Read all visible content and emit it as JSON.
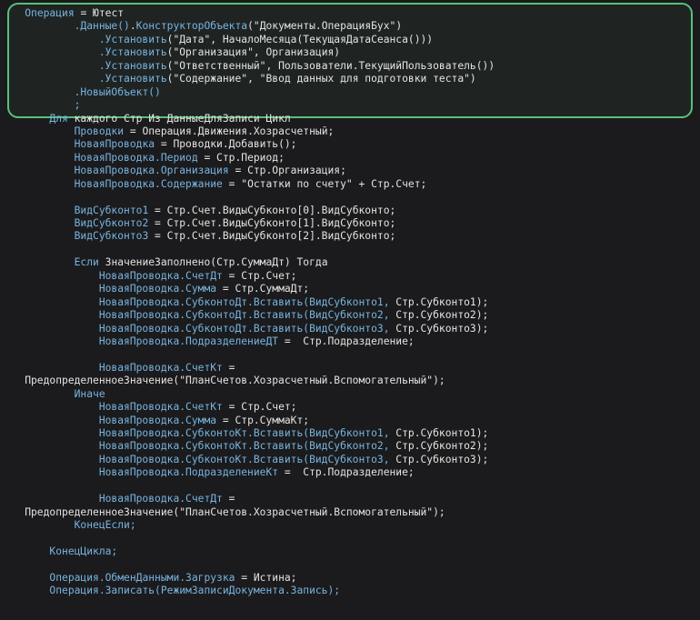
{
  "lines": [
    [
      {
        "t": "    "
      },
      {
        "t": "Операция",
        "c": "id"
      },
      {
        "t": " = Ютест"
      }
    ],
    [
      {
        "t": "            "
      },
      {
        "t": ".Данные()",
        "c": "id"
      },
      {
        "t": "."
      },
      {
        "t": "КонструкторОбъекта",
        "c": "id"
      },
      {
        "t": "(\"Документы.ОперацияБух\")"
      }
    ],
    [
      {
        "t": "                "
      },
      {
        "t": ".Установить",
        "c": "id"
      },
      {
        "t": "(\"Дата\", НачалоМесяца(ТекущаяДатаСеанса()))"
      }
    ],
    [
      {
        "t": "                "
      },
      {
        "t": ".Установить",
        "c": "id"
      },
      {
        "t": "(\"Организация\", Организация)"
      }
    ],
    [
      {
        "t": "                "
      },
      {
        "t": ".Установить",
        "c": "id"
      },
      {
        "t": "(\"Ответственный\", Пользователи.ТекущийПользователь())"
      }
    ],
    [
      {
        "t": "                "
      },
      {
        "t": ".Установить",
        "c": "id"
      },
      {
        "t": "(\"Содержание\", \"Ввод данных для подготовки теста\")"
      }
    ],
    [
      {
        "t": "            "
      },
      {
        "t": ".НовыйОбъект()",
        "c": "id"
      }
    ],
    [
      {
        "t": "            "
      },
      {
        "t": ";",
        "c": "id"
      }
    ],
    [
      {
        "t": "        "
      },
      {
        "t": "Для",
        "c": "kw"
      },
      {
        "t": " каждого Стр Из ДанныеДляЗаписи Цикл"
      }
    ],
    [
      {
        "t": "            "
      },
      {
        "t": "Проводки",
        "c": "id"
      },
      {
        "t": " = Операция.Движения.Хозрасчетный;"
      }
    ],
    [
      {
        "t": "            "
      },
      {
        "t": "НоваяПроводка",
        "c": "id"
      },
      {
        "t": " = Проводки.Добавить();"
      }
    ],
    [
      {
        "t": "            "
      },
      {
        "t": "НоваяПроводка.Период",
        "c": "id"
      },
      {
        "t": " = Стр.Период;"
      }
    ],
    [
      {
        "t": "            "
      },
      {
        "t": "НоваяПроводка.Организация",
        "c": "id"
      },
      {
        "t": " = Стр.Организация;"
      }
    ],
    [
      {
        "t": "            "
      },
      {
        "t": "НоваяПроводка.Содержание",
        "c": "id"
      },
      {
        "t": " = \"Остатки по счету\" + Стр.Счет;"
      }
    ],
    [
      {
        "t": ""
      }
    ],
    [
      {
        "t": "            "
      },
      {
        "t": "ВидСубконто1",
        "c": "id"
      },
      {
        "t": " = Стр.Счет.ВидыСубконто[0].ВидСубконто;"
      }
    ],
    [
      {
        "t": "            "
      },
      {
        "t": "ВидСубконто2",
        "c": "id"
      },
      {
        "t": " = Стр.Счет.ВидыСубконто[1].ВидСубконто;"
      }
    ],
    [
      {
        "t": "            "
      },
      {
        "t": "ВидСубконто3",
        "c": "id"
      },
      {
        "t": " = Стр.Счет.ВидыСубконто[2].ВидСубконто;"
      }
    ],
    [
      {
        "t": ""
      }
    ],
    [
      {
        "t": "            "
      },
      {
        "t": "Если",
        "c": "kw"
      },
      {
        "t": " ЗначениеЗаполнено(Стр.СуммаДт) Тогда"
      }
    ],
    [
      {
        "t": "                "
      },
      {
        "t": "НоваяПроводка.СчетДт",
        "c": "id"
      },
      {
        "t": " = Стр.Счет;"
      }
    ],
    [
      {
        "t": "                "
      },
      {
        "t": "НоваяПроводка.Сумма",
        "c": "id"
      },
      {
        "t": " = Стр.СуммаДт;"
      }
    ],
    [
      {
        "t": "                "
      },
      {
        "t": "НоваяПроводка.СубконтоДт.Вставить(ВидСубконто1,",
        "c": "id"
      },
      {
        "t": " Стр.Субконто1);"
      }
    ],
    [
      {
        "t": "                "
      },
      {
        "t": "НоваяПроводка.СубконтоДт.Вставить(ВидСубконто2,",
        "c": "id"
      },
      {
        "t": " Стр.Субконто2);"
      }
    ],
    [
      {
        "t": "                "
      },
      {
        "t": "НоваяПроводка.СубконтоДт.Вставить(ВидСубконто3,",
        "c": "id"
      },
      {
        "t": " Стр.Субконто3);"
      }
    ],
    [
      {
        "t": "                "
      },
      {
        "t": "НоваяПроводка.ПодразделениеДТ",
        "c": "id"
      },
      {
        "t": " =  Стр.Подразделение;"
      }
    ],
    [
      {
        "t": ""
      }
    ],
    [
      {
        "t": "                "
      },
      {
        "t": "НоваяПроводка.СчетКт",
        "c": "id"
      },
      {
        "t": " ="
      }
    ],
    [
      {
        "t": "    ПредопределенноеЗначение(\"ПланСчетов.Хозрасчетный.Вспомогательный\");"
      }
    ],
    [
      {
        "t": "            "
      },
      {
        "t": "Иначе",
        "c": "kw"
      }
    ],
    [
      {
        "t": "                "
      },
      {
        "t": "НоваяПроводка.СчетКт",
        "c": "id"
      },
      {
        "t": " = Стр.Счет;"
      }
    ],
    [
      {
        "t": "                "
      },
      {
        "t": "НоваяПроводка.Сумма",
        "c": "id"
      },
      {
        "t": " = Стр.СуммаКт;"
      }
    ],
    [
      {
        "t": "                "
      },
      {
        "t": "НоваяПроводка.СубконтоКт.Вставить(ВидСубконто1,",
        "c": "id"
      },
      {
        "t": " Стр.Субконто1);"
      }
    ],
    [
      {
        "t": "                "
      },
      {
        "t": "НоваяПроводка.СубконтоКт.Вставить(ВидСубконто2,",
        "c": "id"
      },
      {
        "t": " Стр.Субконто2);"
      }
    ],
    [
      {
        "t": "                "
      },
      {
        "t": "НоваяПроводка.СубконтоКт.Вставить(ВидСубконто3,",
        "c": "id"
      },
      {
        "t": " Стр.Субконто3);"
      }
    ],
    [
      {
        "t": "                "
      },
      {
        "t": "НоваяПроводка.ПодразделениеКт",
        "c": "id"
      },
      {
        "t": " =  Стр.Подразделение;"
      }
    ],
    [
      {
        "t": ""
      }
    ],
    [
      {
        "t": "                "
      },
      {
        "t": "НоваяПроводка.СчетДт",
        "c": "id"
      },
      {
        "t": " ="
      }
    ],
    [
      {
        "t": "    ПредопределенноеЗначение(\"ПланСчетов.Хозрасчетный.Вспомогательный\");"
      }
    ],
    [
      {
        "t": "            "
      },
      {
        "t": "КонецЕсли;",
        "c": "kw"
      }
    ],
    [
      {
        "t": ""
      }
    ],
    [
      {
        "t": "        "
      },
      {
        "t": "КонецЦикла;",
        "c": "kw"
      }
    ],
    [
      {
        "t": ""
      }
    ],
    [
      {
        "t": "        "
      },
      {
        "t": "Операция.ОбменДанными.Загрузка",
        "c": "id"
      },
      {
        "t": " = Истина;"
      }
    ],
    [
      {
        "t": "        "
      },
      {
        "t": "Операция.Записать(РежимЗаписиДокумента.Запись);",
        "c": "id"
      }
    ]
  ]
}
